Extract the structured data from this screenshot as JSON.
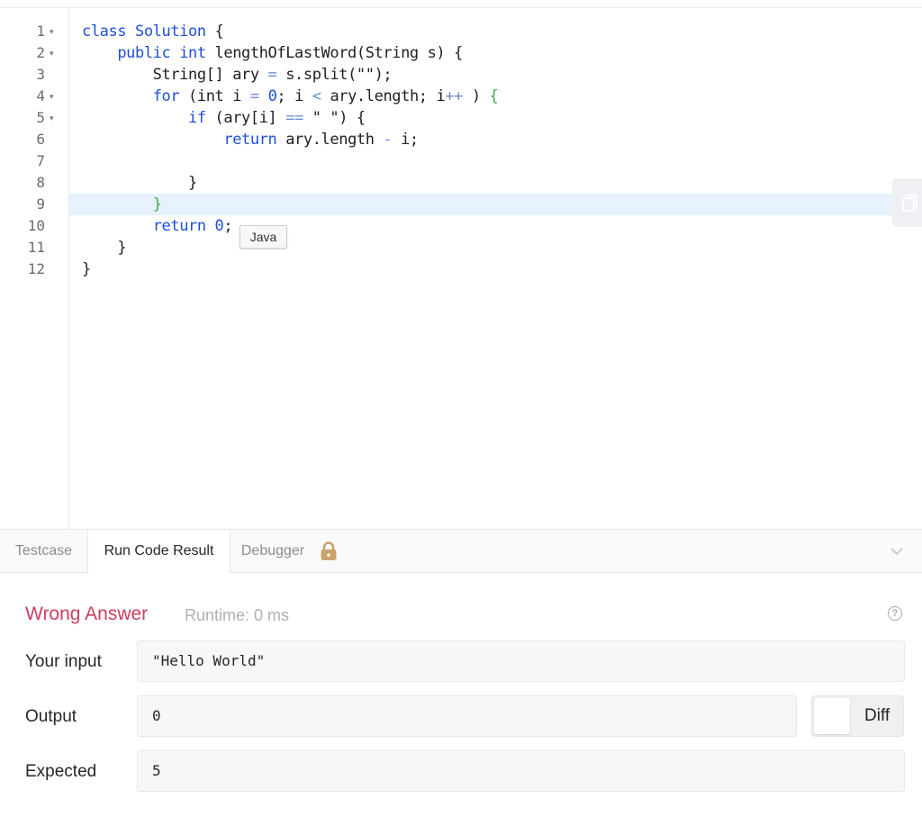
{
  "editor": {
    "line_numbers": [
      "1",
      "2",
      "3",
      "4",
      "5",
      "6",
      "7",
      "8",
      "9",
      "10",
      "11",
      "12"
    ],
    "fold_markers": {
      "1": "▾",
      "2": "▾",
      "4": "▾",
      "5": "▾"
    },
    "language_tooltip": "Java",
    "lines": [
      [
        {
          "t": "class Solution ",
          "c": "kw"
        },
        {
          "t": "{",
          "c": ""
        }
      ],
      [
        {
          "t": "    "
        },
        {
          "t": "public int ",
          "c": "kw"
        },
        {
          "t": "lengthOfLastWord(String s) {",
          "c": ""
        }
      ],
      [
        {
          "t": "        String[] ary "
        },
        {
          "t": "=",
          "c": "op"
        },
        {
          "t": " s.split(\"\");"
        }
      ],
      [
        {
          "t": "        "
        },
        {
          "t": "for ",
          "c": "kw"
        },
        {
          "t": "(int i "
        },
        {
          "t": "=",
          "c": "op"
        },
        {
          "t": " "
        },
        {
          "t": "0",
          "c": "num"
        },
        {
          "t": "; i "
        },
        {
          "t": "<",
          "c": "op"
        },
        {
          "t": " ary.length; i"
        },
        {
          "t": "++",
          "c": "op"
        },
        {
          "t": " ) "
        },
        {
          "t": "{",
          "c": "gr"
        }
      ],
      [
        {
          "t": "            "
        },
        {
          "t": "if ",
          "c": "kw"
        },
        {
          "t": "(ary[i] "
        },
        {
          "t": "==",
          "c": "op"
        },
        {
          "t": " \" \") {"
        }
      ],
      [
        {
          "t": "                "
        },
        {
          "t": "return ",
          "c": "kw"
        },
        {
          "t": "ary.length "
        },
        {
          "t": "-",
          "c": "op"
        },
        {
          "t": " i;"
        }
      ],
      [
        {
          "t": ""
        }
      ],
      [
        {
          "t": "            }"
        }
      ],
      [
        {
          "t": "        "
        },
        {
          "t": "}",
          "c": "gr"
        }
      ],
      [
        {
          "t": "        "
        },
        {
          "t": "return ",
          "c": "kw"
        },
        {
          "t": "0",
          "c": "num"
        },
        {
          "t": ";"
        }
      ],
      [
        {
          "t": "    }"
        }
      ],
      [
        {
          "t": "}"
        }
      ]
    ]
  },
  "tabs": {
    "testcase": "Testcase",
    "run_code_result": "Run Code Result",
    "debugger": "Debugger"
  },
  "result": {
    "status": "Wrong Answer",
    "runtime": "Runtime: 0 ms",
    "input_label": "Your input",
    "input_value": "\"Hello World\"",
    "output_label": "Output",
    "output_value": "0",
    "expected_label": "Expected",
    "expected_value": "5",
    "diff_label": "Diff"
  },
  "colors": {
    "wrong_answer": "#cc3e5f",
    "keyword": "#1f4fd6",
    "bracket_match": "#3aa945",
    "active_line": "#e8f2fe",
    "lock": "#c9a36b"
  },
  "icons": {
    "lock": "lock-icon",
    "chevron": "chevron-down-icon",
    "help": "question-circle-icon",
    "side": "copy-icon"
  }
}
